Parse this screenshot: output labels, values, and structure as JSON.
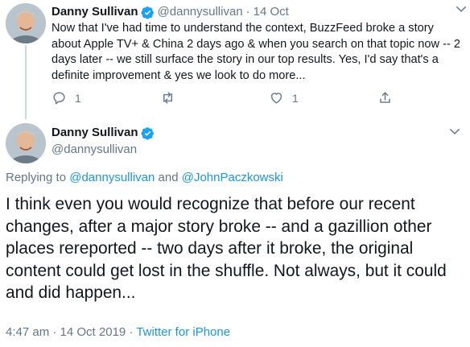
{
  "parent_tweet": {
    "author_name": "Danny Sullivan",
    "handle": "@dannysullivan",
    "separator": "·",
    "date": "14 Oct",
    "text": "Now that I've had time to understand the context, BuzzFeed broke a story about Apple TV+ & China 2 days ago & when you search on that topic now -- 2 days later -- we still surface the story in our top results. Yes, I'd say that's a definite improvement & yes we look to do more...",
    "reply_count": "1",
    "retweet_count": "",
    "like_count": "1"
  },
  "main_tweet": {
    "author_name": "Danny Sullivan",
    "handle": "@dannysullivan",
    "replying_prefix": "Replying to",
    "replying_to_1": "@dannysullivan",
    "replying_and": "and",
    "replying_to_2": "@JohnPaczkowski",
    "text": "I think even you would recognize that before our recent changes, after a major story broke -- and a gazillion other places rereported -- two days after it broke, the original content could get lost in the shuffle. Not always, but it could and did happen...",
    "timestamp": "4:47 am · 14 Oct 2019",
    "meta_separator": "·",
    "source": "Twitter for iPhone"
  },
  "icons": {
    "verified": "verified-badge-icon",
    "caret": "chevron-down-icon",
    "reply": "reply-icon",
    "retweet": "retweet-icon",
    "like": "heart-icon",
    "share": "share-icon"
  },
  "colors": {
    "text": "#14171a",
    "secondary": "#657786",
    "link": "#1b95e0",
    "verified": "#1da1f2",
    "thread_line": "#ccd6dd"
  }
}
